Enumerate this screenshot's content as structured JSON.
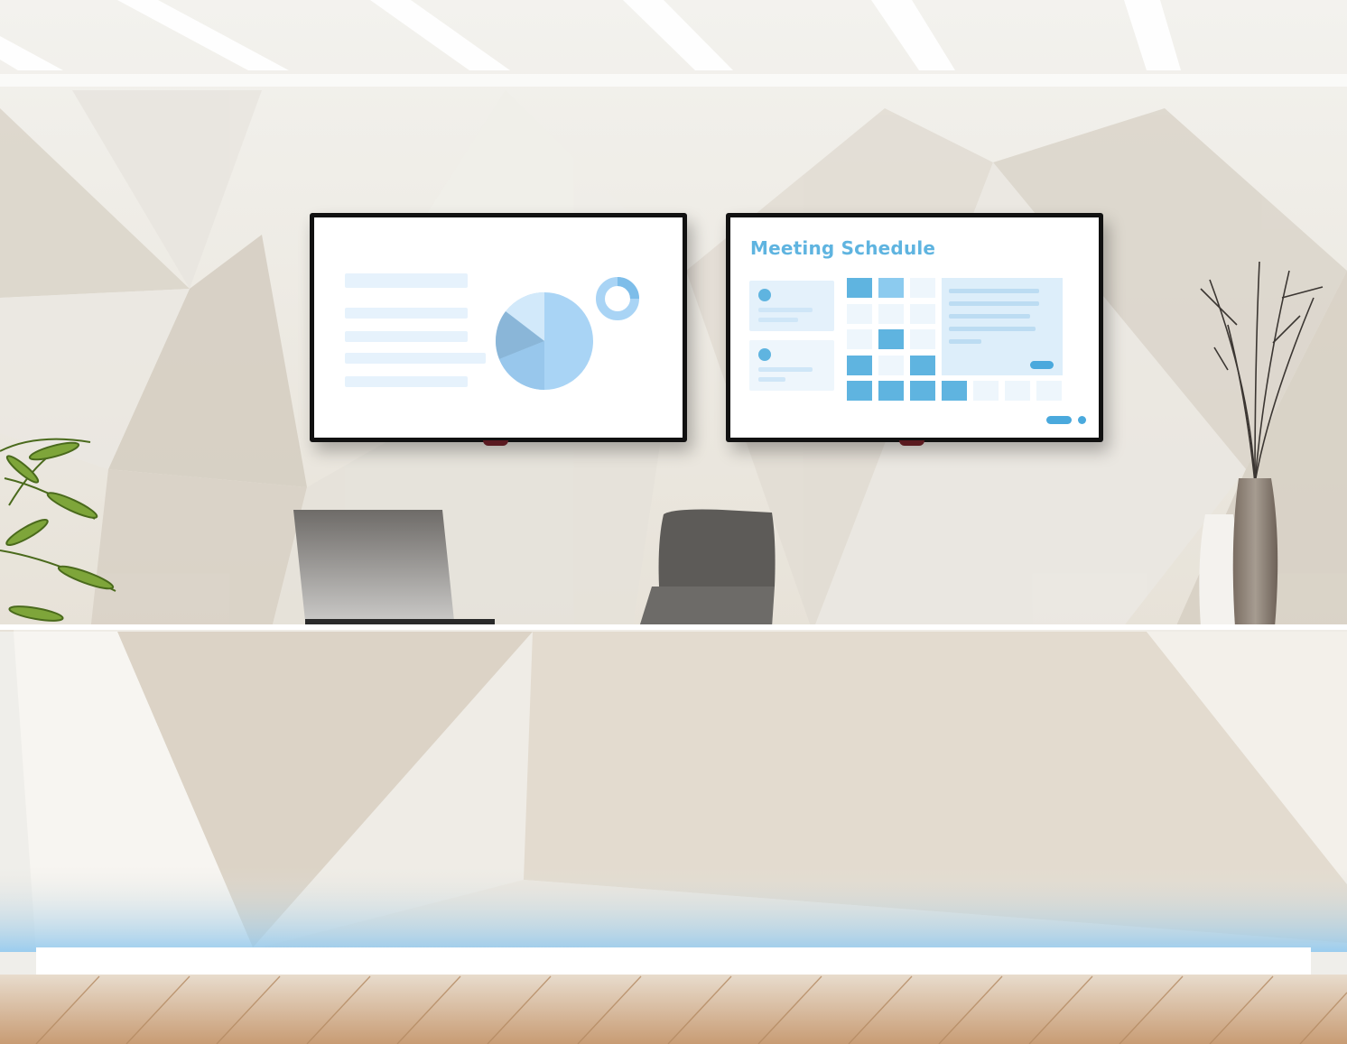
{
  "right_display": {
    "title": "Meeting Schedule"
  },
  "colors": {
    "accent": "#5fb4e0",
    "wall": "#efeeea",
    "screen_bg": "#ffffff",
    "floor": "#c9a07a"
  },
  "icons": {
    "pie": "pie-chart-icon",
    "donut": "donut-chart-icon"
  }
}
